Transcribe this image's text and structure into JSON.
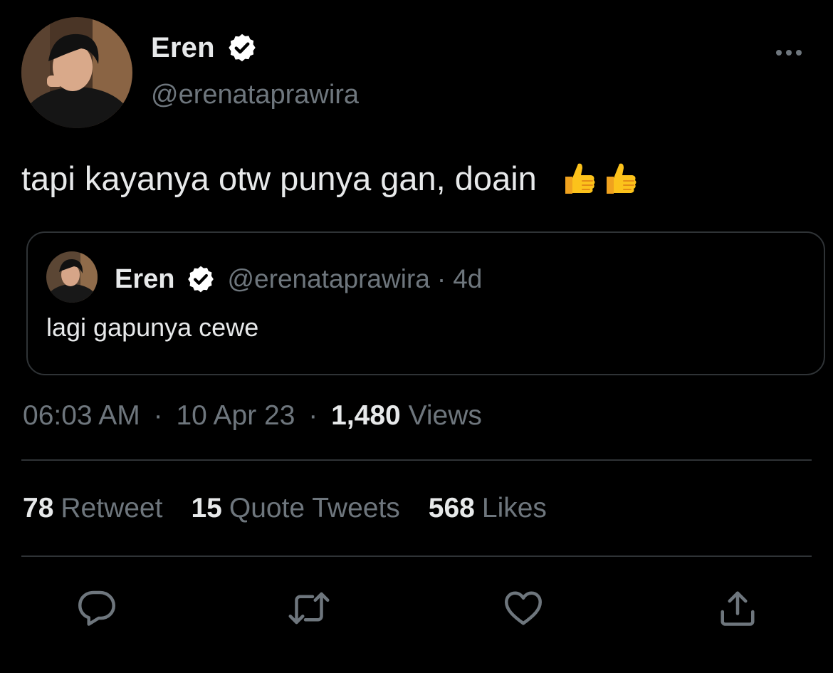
{
  "author": {
    "name": "Eren",
    "handle": "@erenataprawira",
    "verified": true
  },
  "tweet": {
    "text": "tapi kayanya otw punya gan, doain",
    "emojis": [
      "thumbs-up-emoji",
      "thumbs-up-emoji"
    ]
  },
  "quoted_tweet": {
    "name": "Eren",
    "handle": "@erenataprawira",
    "separator": "·",
    "time": "4d",
    "text": "lagi gapunya cewe"
  },
  "meta": {
    "time": "06:03 AM",
    "separator": "·",
    "date": "10 Apr 23",
    "separator2": "·",
    "views_count": "1,480",
    "views_label": "Views"
  },
  "stats": {
    "retweets": {
      "count": "78",
      "label": "Retweet"
    },
    "quotes": {
      "count": "15",
      "label": "Quote Tweets"
    },
    "likes": {
      "count": "568",
      "label": "Likes"
    }
  },
  "icons": {
    "more": "more-horizontal-icon",
    "reply": "reply-icon",
    "retweet": "retweet-icon",
    "like": "heart-icon",
    "share": "share-icon",
    "verified": "verified-badge-icon"
  },
  "colors": {
    "background": "#000000",
    "text_primary": "#e7e9ea",
    "text_secondary": "#6e767d",
    "border": "#2f3336"
  }
}
